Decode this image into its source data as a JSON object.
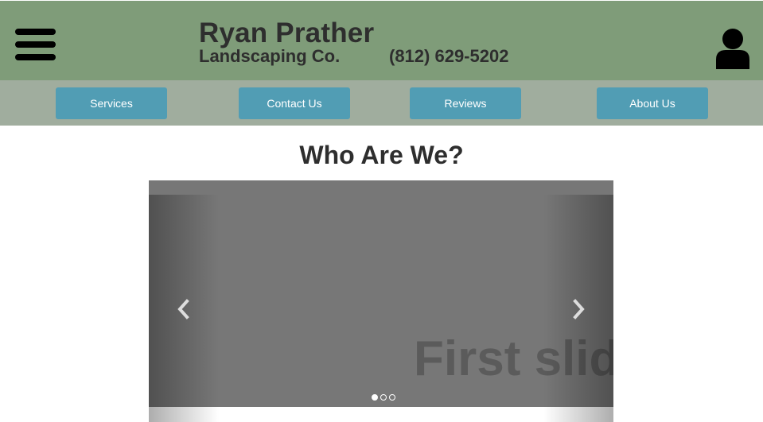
{
  "header": {
    "brand_name": "Ryan Prather",
    "brand_sub": "Landscaping Co.",
    "phone": "(812) 629-5202",
    "icons": {
      "menu": "hamburger-menu-icon",
      "account": "user-icon"
    }
  },
  "nav": {
    "items": [
      {
        "label": "Services"
      },
      {
        "label": "Contact Us"
      },
      {
        "label": "Reviews"
      },
      {
        "label": "About Us"
      }
    ]
  },
  "main": {
    "title": "Who Are We?",
    "carousel": {
      "slide_text": "First slide",
      "active_index": 0,
      "indicator_count": 3,
      "icons": {
        "prev": "chevron-left-icon",
        "next": "chevron-right-icon"
      }
    }
  },
  "colors": {
    "header_bg": "#7f9c79",
    "nav_bg": "#a0ad9e",
    "button_bg": "#519db4",
    "button_text": "#ffffff",
    "text_dark": "#2e2e2e",
    "slide_bg": "#777777"
  }
}
